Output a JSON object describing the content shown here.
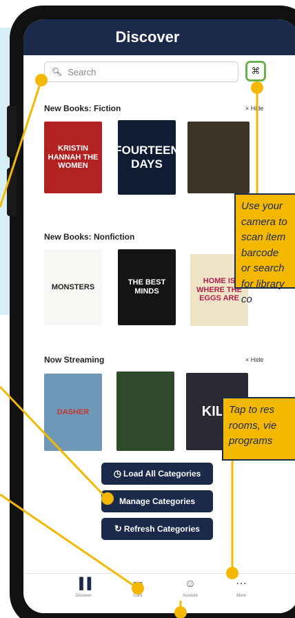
{
  "header": {
    "title": "Discover"
  },
  "search": {
    "placeholder": "Search"
  },
  "sections": [
    {
      "title": "New Books: Fiction",
      "hide_label": "× Hide",
      "covers": [
        {
          "text": "KRISTIN HANNAH THE WOMEN",
          "bg": "#b22222"
        },
        {
          "text": "FOURTEEN DAYS",
          "bg": "#0f1c33"
        },
        {
          "text": "",
          "bg": "#3e3426"
        }
      ]
    },
    {
      "title": "New Books: Nonfiction",
      "hide_label": "",
      "covers": [
        {
          "text": "MONSTERS",
          "bg": "#f7f7f4"
        },
        {
          "text": "THE BEST MINDS",
          "bg": "#141414"
        },
        {
          "text": "HOME IS WHERE THE EGGS ARE",
          "bg": "#efe3c8"
        }
      ]
    },
    {
      "title": "Now Streaming",
      "hide_label": "× Hide",
      "covers": [
        {
          "text": "DASHER",
          "bg": "#6f98b8"
        },
        {
          "text": "",
          "bg": "#2f4a2a"
        },
        {
          "text": "KILL",
          "bg": "#2a2a32"
        }
      ]
    }
  ],
  "buttons": {
    "load_all": "Load All Categories",
    "manage": "Manage Categories",
    "refresh": "Refresh Categories"
  },
  "tabs": [
    {
      "label": "Discover",
      "icon": "books-icon"
    },
    {
      "label": "Card",
      "icon": "card-icon"
    },
    {
      "label": "Account",
      "icon": "account-icon"
    },
    {
      "label": "More",
      "icon": "more-icon"
    }
  ],
  "callouts": {
    "scan": "Use your camera to scan item barcode or search for library co",
    "more": "Tap to res rooms, vie programs"
  },
  "colors": {
    "brand": "#1b2a4a",
    "accent": "#f5b800",
    "scan_border": "#6ab04c",
    "panel": "#d6eef5"
  }
}
